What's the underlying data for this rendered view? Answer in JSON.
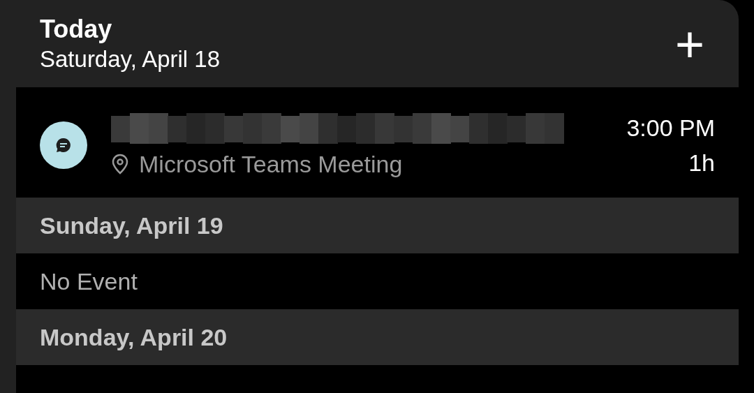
{
  "header": {
    "title": "Today",
    "date": "Saturday, April 18",
    "add_button": "+"
  },
  "days": [
    {
      "kind": "events",
      "events": [
        {
          "title_redacted": true,
          "location": "Microsoft Teams Meeting",
          "time": "3:00 PM",
          "duration": "1h"
        }
      ]
    },
    {
      "kind": "heading",
      "label": "Sunday, April 19"
    },
    {
      "kind": "empty",
      "label": "No Event"
    },
    {
      "kind": "heading",
      "label": "Monday, April 20"
    }
  ]
}
